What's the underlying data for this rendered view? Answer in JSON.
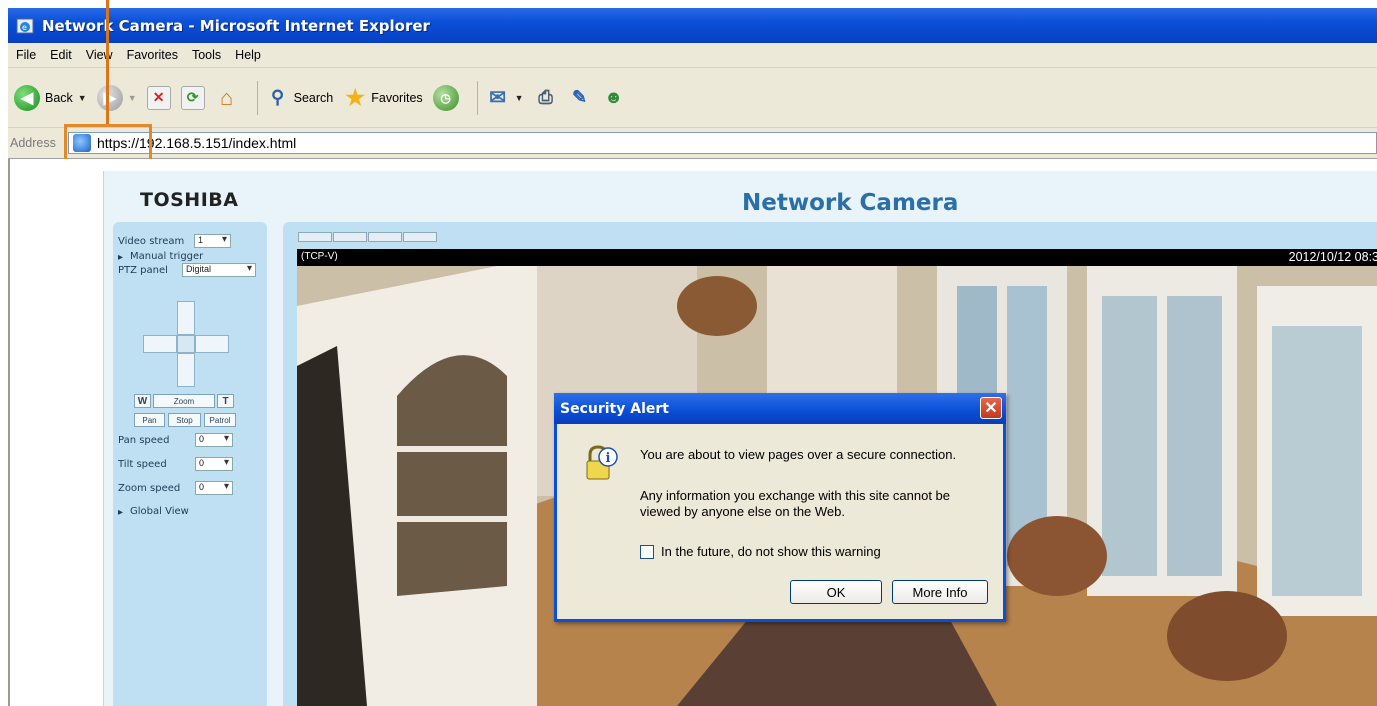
{
  "window": {
    "title": "Network Camera - Microsoft Internet Explorer"
  },
  "menu": [
    "File",
    "Edit",
    "View",
    "Favorites",
    "Tools",
    "Help"
  ],
  "toolbar": {
    "back_label": "Back",
    "search_label": "Search",
    "favorites_label": "Favorites"
  },
  "address": {
    "label": "Address",
    "url": "https://192.168.5.151/index.html"
  },
  "page": {
    "brand": "TOSHIBA",
    "title": "Network Camera",
    "video_stream_label": "Video stream",
    "video_stream_value": "1",
    "manual_trigger_label": "Manual trigger",
    "ptz_panel_label": "PTZ panel",
    "ptz_panel_value": "Digital",
    "w_label": "W",
    "zoom_label": "Zoom",
    "t_label": "T",
    "pan_label": "Pan",
    "stop_label": "Stop",
    "patrol_label": "Patrol",
    "pan_speed_label": "Pan speed",
    "pan_speed_value": "0",
    "tilt_speed_label": "Tilt speed",
    "tilt_speed_value": "0",
    "zoom_speed_label": "Zoom speed",
    "zoom_speed_value": "0",
    "global_view_label": "Global View",
    "video_protocol": "(TCP-V)",
    "timestamp": "2012/10/12 08:3"
  },
  "dialog": {
    "title": "Security Alert",
    "message1": "You are about to view pages over a secure connection.",
    "message2": "Any information you exchange with this site cannot be viewed by anyone else on the Web.",
    "checkbox_label": "In the future, do not show this warning",
    "ok_label": "OK",
    "more_info_label": "More Info"
  }
}
